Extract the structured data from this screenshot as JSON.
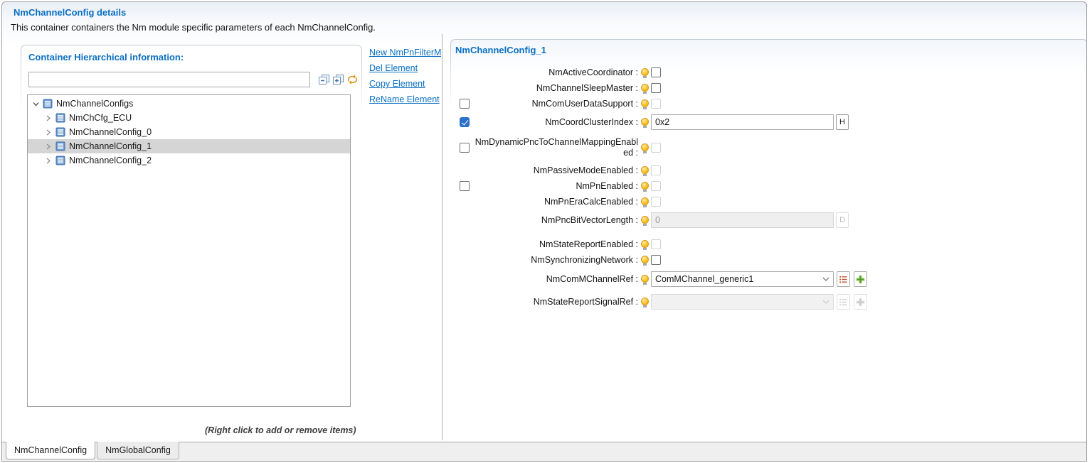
{
  "page": {
    "title": "NmChannelConfig details",
    "description": "This container containers the Nm module specific parameters of each NmChannelConfig."
  },
  "left_panel": {
    "title": "Container Hierarchical information:",
    "search": {
      "value": "",
      "placeholder": ""
    },
    "toolbar_icons": [
      "collapse-all",
      "expand-all",
      "refresh"
    ],
    "tree": {
      "items": [
        {
          "label": "NmChannelConfigs",
          "level": 0,
          "expanded": true,
          "selected": false
        },
        {
          "label": "NmChCfg_ECU",
          "level": 1,
          "expanded": false,
          "selected": false
        },
        {
          "label": "NmChannelConfig_0",
          "level": 1,
          "expanded": false,
          "selected": false
        },
        {
          "label": "NmChannelConfig_1",
          "level": 1,
          "expanded": false,
          "selected": true
        },
        {
          "label": "NmChannelConfig_2",
          "level": 1,
          "expanded": false,
          "selected": false
        }
      ]
    },
    "hint": "(Right click to add or remove items)"
  },
  "actions": [
    {
      "label": "New NmPnFilterM"
    },
    {
      "label": "Del Element"
    },
    {
      "label": "Copy Element"
    },
    {
      "label": "ReName Element"
    }
  ],
  "right_panel": {
    "title": "NmChannelConfig_1",
    "fields": [
      {
        "label": "NmActiveCoordinator :",
        "type": "checkbox",
        "checked": false,
        "enabled": true
      },
      {
        "label": "NmChannelSleepMaster :",
        "type": "checkbox",
        "checked": false,
        "enabled": true
      },
      {
        "label": "NmComUserDataSupport :",
        "type": "checkbox",
        "checked": false,
        "enabled": false,
        "override_checkbox": {
          "present": true,
          "checked": false
        }
      },
      {
        "label": "NmCoordClusterIndex :",
        "type": "text",
        "value": "0x2",
        "suffix_button": "H",
        "enabled": true,
        "override_checkbox": {
          "present": true,
          "checked": true
        }
      },
      {
        "label": "NmDynamicPncToChannelMappingEnabled :",
        "type": "checkbox",
        "checked": false,
        "enabled": false,
        "override_checkbox": {
          "present": true,
          "checked": false
        }
      },
      {
        "label": "NmPassiveModeEnabled :",
        "type": "checkbox",
        "checked": false,
        "enabled": false
      },
      {
        "label": "NmPnEnabled :",
        "type": "checkbox",
        "checked": false,
        "enabled": false,
        "override_checkbox": {
          "present": true,
          "checked": false
        }
      },
      {
        "label": "NmPnEraCalcEnabled :",
        "type": "checkbox",
        "checked": false,
        "enabled": false
      },
      {
        "label": "NmPncBitVectorLength :",
        "type": "text",
        "value": "0",
        "suffix_button": "D",
        "enabled": false
      },
      {
        "label": "NmStateReportEnabled :",
        "type": "checkbox",
        "checked": false,
        "enabled": false
      },
      {
        "label": "NmSynchronizingNetwork :",
        "type": "checkbox",
        "checked": false,
        "enabled": true
      },
      {
        "label": "NmComMChannelRef :",
        "type": "dropdown",
        "value": "ComMChannel_generic1",
        "enabled": true,
        "buttons": [
          "list",
          "add"
        ]
      },
      {
        "label": "NmStateReportSignalRef :",
        "type": "dropdown",
        "value": "",
        "enabled": false,
        "buttons": [
          "list",
          "add"
        ]
      }
    ]
  },
  "tabs": [
    {
      "label": "NmChannelConfig",
      "active": true
    },
    {
      "label": "NmGlobalConfig",
      "active": false
    }
  ],
  "colors": {
    "heading_blue": "#0a6fc2",
    "link_blue": "#0a6fc2",
    "tree_selection_gray": "#d5d5d5",
    "checked_checkbox_blue": "#2b71c7",
    "bulb_yellow": "#f7b500",
    "add_green": "#4aa02c",
    "list_icon_orange": "#c0522c"
  }
}
